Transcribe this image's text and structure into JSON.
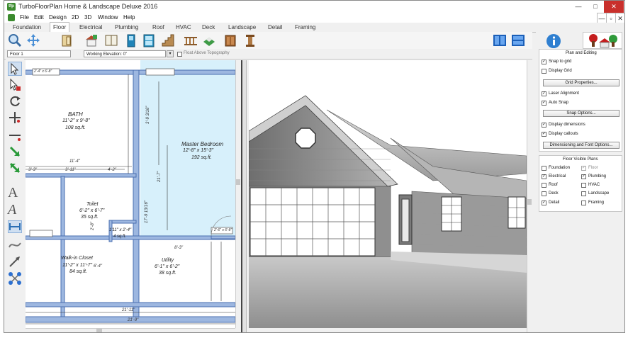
{
  "app": {
    "title": "TurboFloorPlan Home & Landscape Deluxe 2016",
    "logo_text": "tfp"
  },
  "window_controls": [
    "—",
    "□",
    "✕"
  ],
  "inner_controls": [
    "—",
    "▫",
    "✕"
  ],
  "menu": [
    "File",
    "Edit",
    "Design",
    "2D",
    "3D",
    "Window",
    "Help"
  ],
  "tabs": [
    "Foundation",
    "Floor",
    "Electrical",
    "Plumbing",
    "Roof",
    "HVAC",
    "Deck",
    "Landscape",
    "Detail",
    "Framing"
  ],
  "active_tab": "Floor",
  "options_bar": {
    "floor_select": "Floor 1",
    "elevation_label": "Working Elevation: 0\"",
    "float_label": "Float Above Topography"
  },
  "plan": {
    "rooms": [
      {
        "name": "BATH",
        "dims": "11'-2\" x 9'-8\"",
        "area": "108 sq.ft."
      },
      {
        "name": "Master Bedroom",
        "dims": "12'-8\" x 15'-3\"",
        "area": "192 sq.ft."
      },
      {
        "name": "Toilet",
        "dims": "6'-2\" x 6'-7\"",
        "area": "35 sq.ft."
      },
      {
        "name": "",
        "dims": "1'11\" x 2'-4\"",
        "area": "4 sq.ft."
      },
      {
        "name": "Walk-in Closet",
        "dims": "11'-2\" x 11'-7\"",
        "area": "84 sq.ft."
      },
      {
        "name": "Utility",
        "dims": "6'-1\" x 6'-2\"",
        "area": "38 sq.ft."
      }
    ],
    "dims": [
      "11'-4\"",
      "3'-3\"",
      "3'-11\"",
      "4'-2\"",
      "21'-7\"",
      "17'-9 13/16\"",
      "3'-9 3/16\"",
      "8'-3\"",
      "6'-4\"",
      "2'-8\"",
      "21'-11\"",
      "21'-9\"",
      "2'-4\" x 6'-8\"",
      "2'-6\" x 6'-8\""
    ]
  },
  "panel": {
    "tabs_icons": [
      "info-icon",
      "landscape-trees-icon"
    ],
    "plan_editing_title": "Plan and Editing",
    "snap_to_grid": "Snap to grid",
    "display_grid": "Display Grid",
    "grid_properties_btn": "Grid Properties...",
    "laser_alignment": "Laser Alignment",
    "auto_snap": "Auto Snap",
    "snap_options_btn": "Snap Options...",
    "display_dimensions": "Display dimensions",
    "display_callouts": "Display callouts",
    "dim_font_btn": "Dimensioning and Font Options...",
    "floor_visible_title": "Floor Visible Plans",
    "visible_plans": [
      {
        "label": "Foundation",
        "checked": false
      },
      {
        "label": "Floor",
        "checked": true
      },
      {
        "label": "Electrical",
        "checked": true
      },
      {
        "label": "Plumbing",
        "checked": true
      },
      {
        "label": "Roof",
        "checked": false
      },
      {
        "label": "HVAC",
        "checked": false
      },
      {
        "label": "Deck",
        "checked": false
      },
      {
        "label": "Landscape",
        "checked": false
      },
      {
        "label": "Detail",
        "checked": true
      },
      {
        "label": "Framing",
        "checked": false
      }
    ]
  },
  "colors": {
    "wall_blue": "#9db7e0",
    "wall_outline": "#4a6fb0",
    "bedroom_fill": "#d7f0fb",
    "accent_blue": "#2f7fd0"
  }
}
